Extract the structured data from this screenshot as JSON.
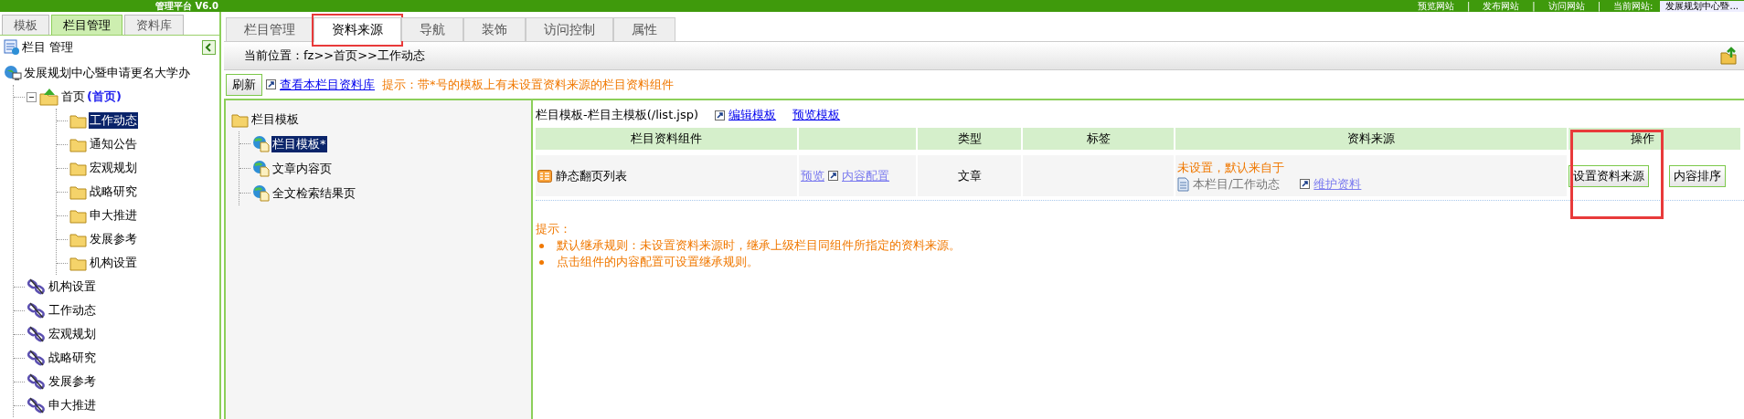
{
  "header": {
    "title": "管理平台 V6.0",
    "links": [
      "预览网站",
      "发布网站",
      "访问网站"
    ],
    "separator": "|",
    "current_site_label": "当前网站:",
    "current_site": "发展规划中心暨..."
  },
  "left_tabs": [
    {
      "label": "模板",
      "selected": false
    },
    {
      "label": "栏目管理",
      "selected": true
    },
    {
      "label": "资料库",
      "selected": false
    }
  ],
  "panel_title": "栏目 管理",
  "tree": {
    "label": "发展规划中心暨申请更名大学办",
    "kind": "root",
    "selected": false,
    "children": [
      {
        "label": "首页",
        "tag": "(首页)",
        "kind": "home",
        "selected": false,
        "expanded": true,
        "children": [
          {
            "label": "工作动态",
            "kind": "folder",
            "selected": true
          },
          {
            "label": "通知公告",
            "kind": "folder",
            "selected": false
          },
          {
            "label": "宏观规划",
            "kind": "folder",
            "selected": false
          },
          {
            "label": "战略研究",
            "kind": "folder",
            "selected": false
          },
          {
            "label": "申大推进",
            "kind": "folder",
            "selected": false
          },
          {
            "label": "发展参考",
            "kind": "folder",
            "selected": false
          },
          {
            "label": "机构设置",
            "kind": "folder",
            "selected": false
          }
        ]
      },
      {
        "label": "机构设置",
        "kind": "link",
        "selected": false
      },
      {
        "label": "工作动态",
        "kind": "link",
        "selected": false
      },
      {
        "label": "宏观规划",
        "kind": "link",
        "selected": false
      },
      {
        "label": "战略研究",
        "kind": "link",
        "selected": false
      },
      {
        "label": "发展参考",
        "kind": "link",
        "selected": false
      },
      {
        "label": "申大推进",
        "kind": "link",
        "selected": false
      }
    ]
  },
  "tabs": [
    {
      "label": "栏目管理",
      "selected": false,
      "highlighted": false
    },
    {
      "label": "资料来源",
      "selected": true,
      "highlighted": true
    },
    {
      "label": "导航",
      "selected": false,
      "highlighted": false
    },
    {
      "label": "装饰",
      "selected": false,
      "highlighted": false
    },
    {
      "label": "访问控制",
      "selected": false,
      "highlighted": false
    },
    {
      "label": "属性",
      "selected": false,
      "highlighted": false
    }
  ],
  "breadcrumb": "当前位置：fz>>首页>>工作动态",
  "toolbar": {
    "refresh": "刷新",
    "library_link": "查看本栏目资料库",
    "hint": "提示：带*号的模板上有未设置资料来源的栏目资料组件"
  },
  "template_tree": {
    "label": "栏目模板",
    "children": [
      {
        "label": "栏目模板",
        "mark": "*",
        "selected": true
      },
      {
        "label": "文章内容页",
        "selected": false
      },
      {
        "label": "全文检索结果页",
        "selected": false
      }
    ]
  },
  "template": {
    "title": "栏目模板-栏目主模板(/list.jsp)",
    "edit_link": "编辑模板",
    "preview_link": "预览模板"
  },
  "table": {
    "columns": [
      {
        "label": "栏目资料组件",
        "highlighted": false
      },
      {
        "highlighted": false
      },
      {
        "label": "类型",
        "highlighted": false
      },
      {
        "label": "标签",
        "highlighted": false
      },
      {
        "label": "资料来源",
        "highlighted": false
      },
      {
        "label": "操作",
        "highlighted": true
      }
    ],
    "rows": [
      {
        "component": "静态翻页列表",
        "preview": "预览",
        "config": "内容配置",
        "type": "文章",
        "source_status": "未设置，默认来自于",
        "source_path": "本栏目/工作动态",
        "maintain": "维护资料",
        "actions": [
          "设置资料来源",
          "内容排序"
        ]
      }
    ]
  },
  "hints": {
    "title": "提示：",
    "items": [
      "默认继承规则：未设置资料来源时，继承上级栏目同组件所指定的资料来源。",
      "点击组件的内容配置可设置继承规则。"
    ]
  }
}
